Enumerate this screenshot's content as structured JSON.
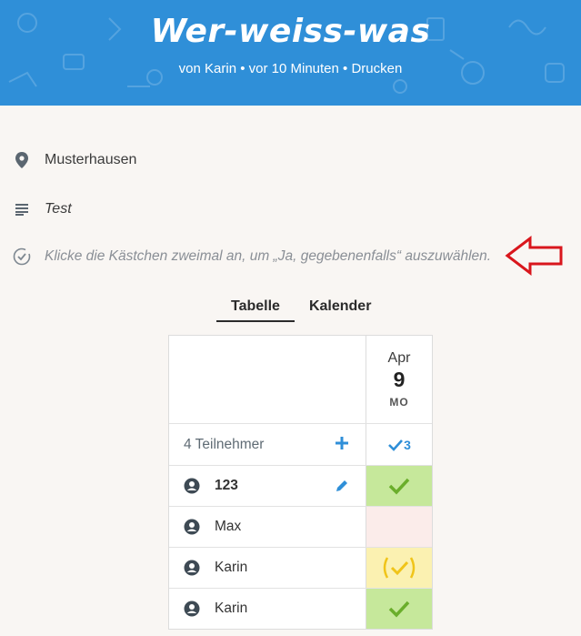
{
  "header": {
    "title": "Wer-weiss-was",
    "meta_author": "von Karin",
    "meta_time": "vor 10 Minuten",
    "meta_print": "Drucken",
    "bg_color": "#2f8fd8"
  },
  "info": {
    "location": "Musterhausen",
    "description": "Test",
    "hint": "Klicke die Kästchen zweimal an, um „Ja, gegebenenfalls“ auszuwählen."
  },
  "tabs": {
    "table": "Tabelle",
    "calendar": "Kalender"
  },
  "poll": {
    "date": {
      "month": "Apr",
      "day": "9",
      "weekday": "MO"
    },
    "participants_label": "4 Teilnehmer",
    "yes_count": "3",
    "participants": [
      {
        "name": "123",
        "vote": "yes",
        "editable": true
      },
      {
        "name": "Max",
        "vote": "no",
        "editable": false
      },
      {
        "name": "Karin",
        "vote": "maybe",
        "editable": false
      },
      {
        "name": "Karin",
        "vote": "yes",
        "editable": false
      }
    ]
  },
  "colors": {
    "yes": "#c6e89b",
    "no": "#fbecea",
    "maybe": "#fbf1b1",
    "accent": "#2f8fd8",
    "annotation_arrow": "#d9161c"
  },
  "icons": [
    "location-pin-icon",
    "description-lines-icon",
    "check-circle-icon",
    "plus-icon",
    "check-icon",
    "user-avatar-icon",
    "pencil-icon",
    "arrow-left-icon"
  ]
}
